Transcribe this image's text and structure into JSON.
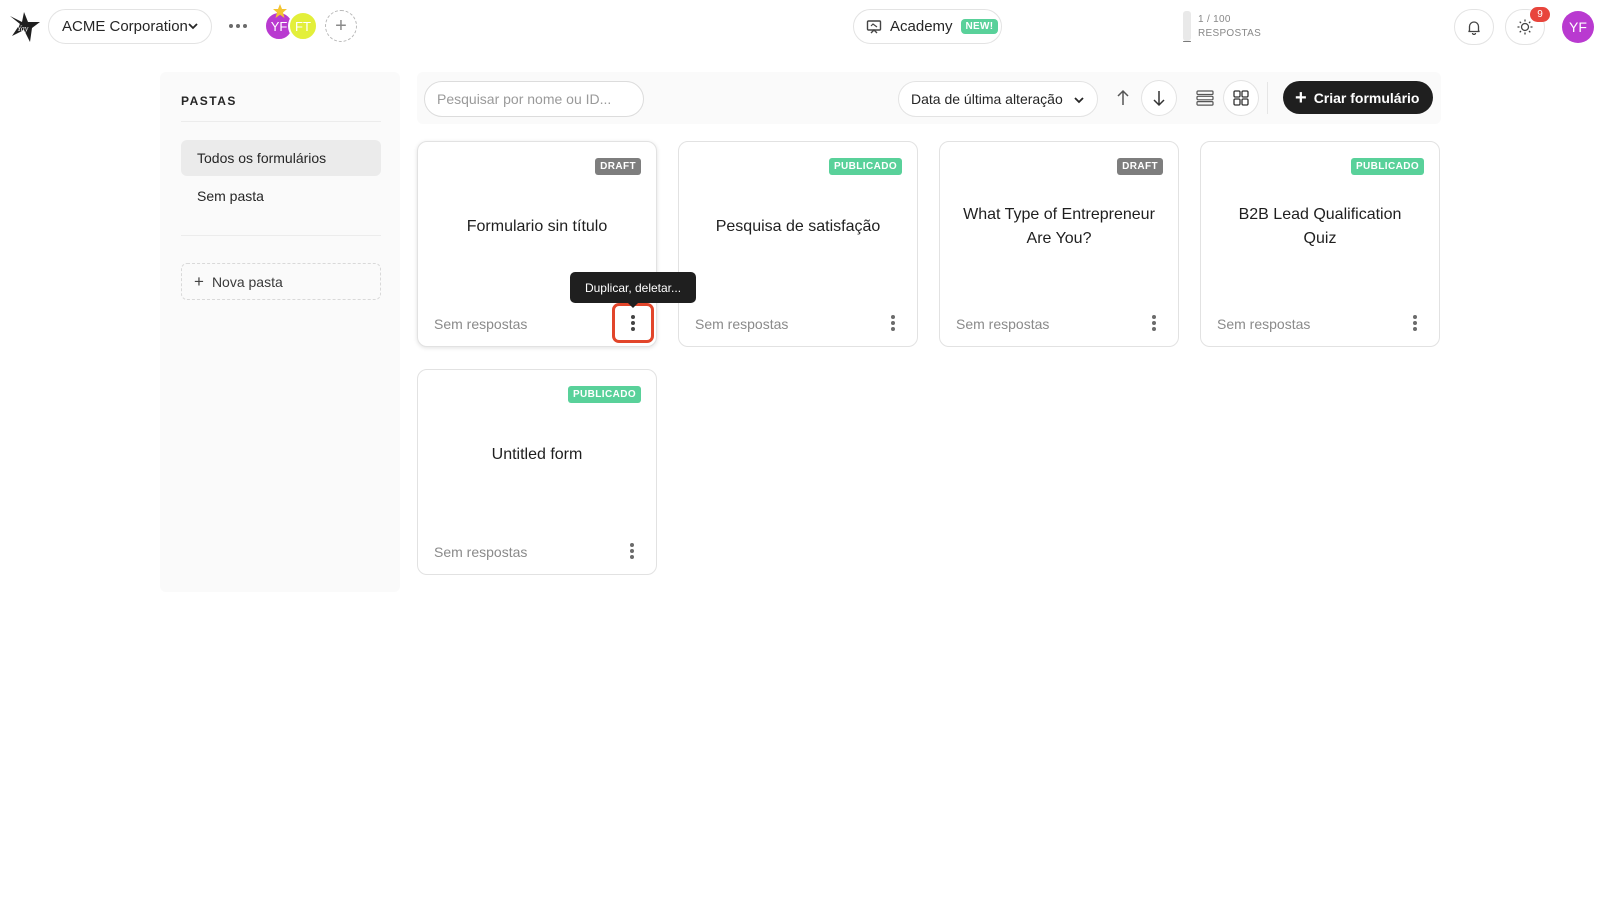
{
  "header": {
    "workspace_name": "ACME Corporation",
    "members": [
      {
        "initials": "YF",
        "color": "#b93ad0"
      },
      {
        "initials": "FT",
        "color": "#e3ef3a"
      }
    ],
    "academy_label": "Academy",
    "academy_badge": "NEW!",
    "responses_usage": "1 / 100",
    "responses_label": "RESPOSTAS",
    "notification_count": "9",
    "user_initials": "YF",
    "accent_color": "#b93ad0"
  },
  "sidebar": {
    "title": "PASTAS",
    "items": [
      {
        "label": "Todos os formulários",
        "active": true
      },
      {
        "label": "Sem pasta",
        "active": false
      }
    ],
    "new_folder_label": "Nova pasta"
  },
  "toolbar": {
    "search_placeholder": "Pesquisar por nome ou ID...",
    "sort_value": "Data de última alteração",
    "create_label": "Criar formulário"
  },
  "forms": [
    {
      "title": "Formulario sin título",
      "status": "DRAFT",
      "responses": "Sem respostas"
    },
    {
      "title": "Pesquisa de satisfação",
      "status": "PUBLICADO",
      "responses": "Sem respostas"
    },
    {
      "title": "What Type of Entrepreneur Are You?",
      "status": "DRAFT",
      "responses": "Sem respostas"
    },
    {
      "title": "B2B Lead Qualification Quiz",
      "status": "PUBLICADO",
      "responses": "Sem respostas"
    },
    {
      "title": "Untitled form",
      "status": "PUBLICADO",
      "responses": "Sem respostas"
    }
  ],
  "tooltip": "Duplicar, deletar...",
  "status_colors": {
    "draft": "#7e7e7e",
    "published": "#59d19a"
  }
}
